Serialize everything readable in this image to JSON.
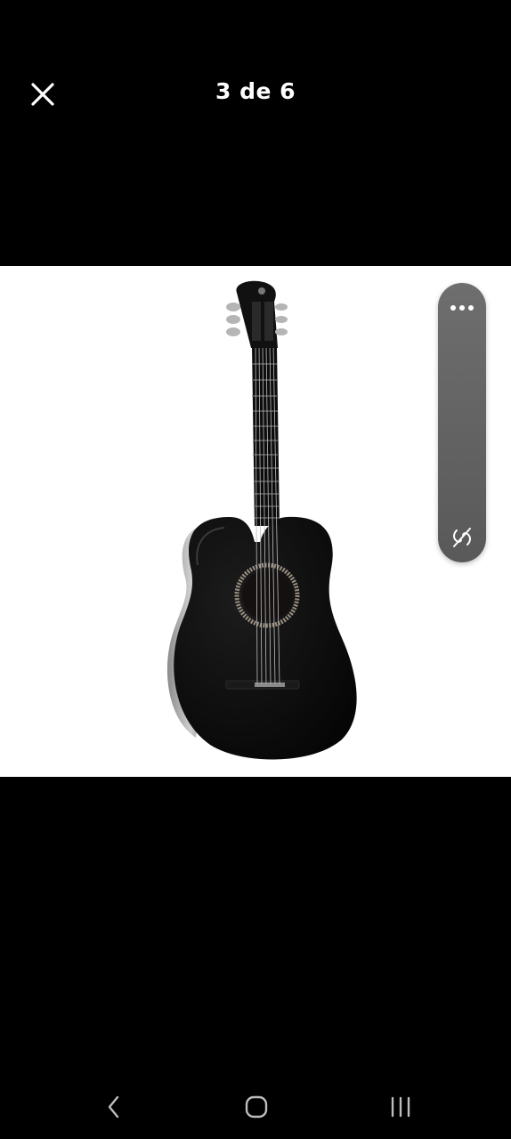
{
  "header": {
    "counter_text": "3 de 6",
    "close_icon": "close-icon"
  },
  "image": {
    "subject_icon": "guitar-image"
  },
  "floating_panel": {
    "more_icon": "more-horizontal-icon",
    "hide_icon": "eye-off-icon"
  },
  "nav_bar": {
    "back_icon": "chevron-left-icon",
    "home_icon": "home-icon",
    "recents_icon": "recents-icon"
  },
  "colors": {
    "background": "#000000",
    "image_background": "#ffffff",
    "panel": "#636363",
    "text": "#ffffff"
  }
}
